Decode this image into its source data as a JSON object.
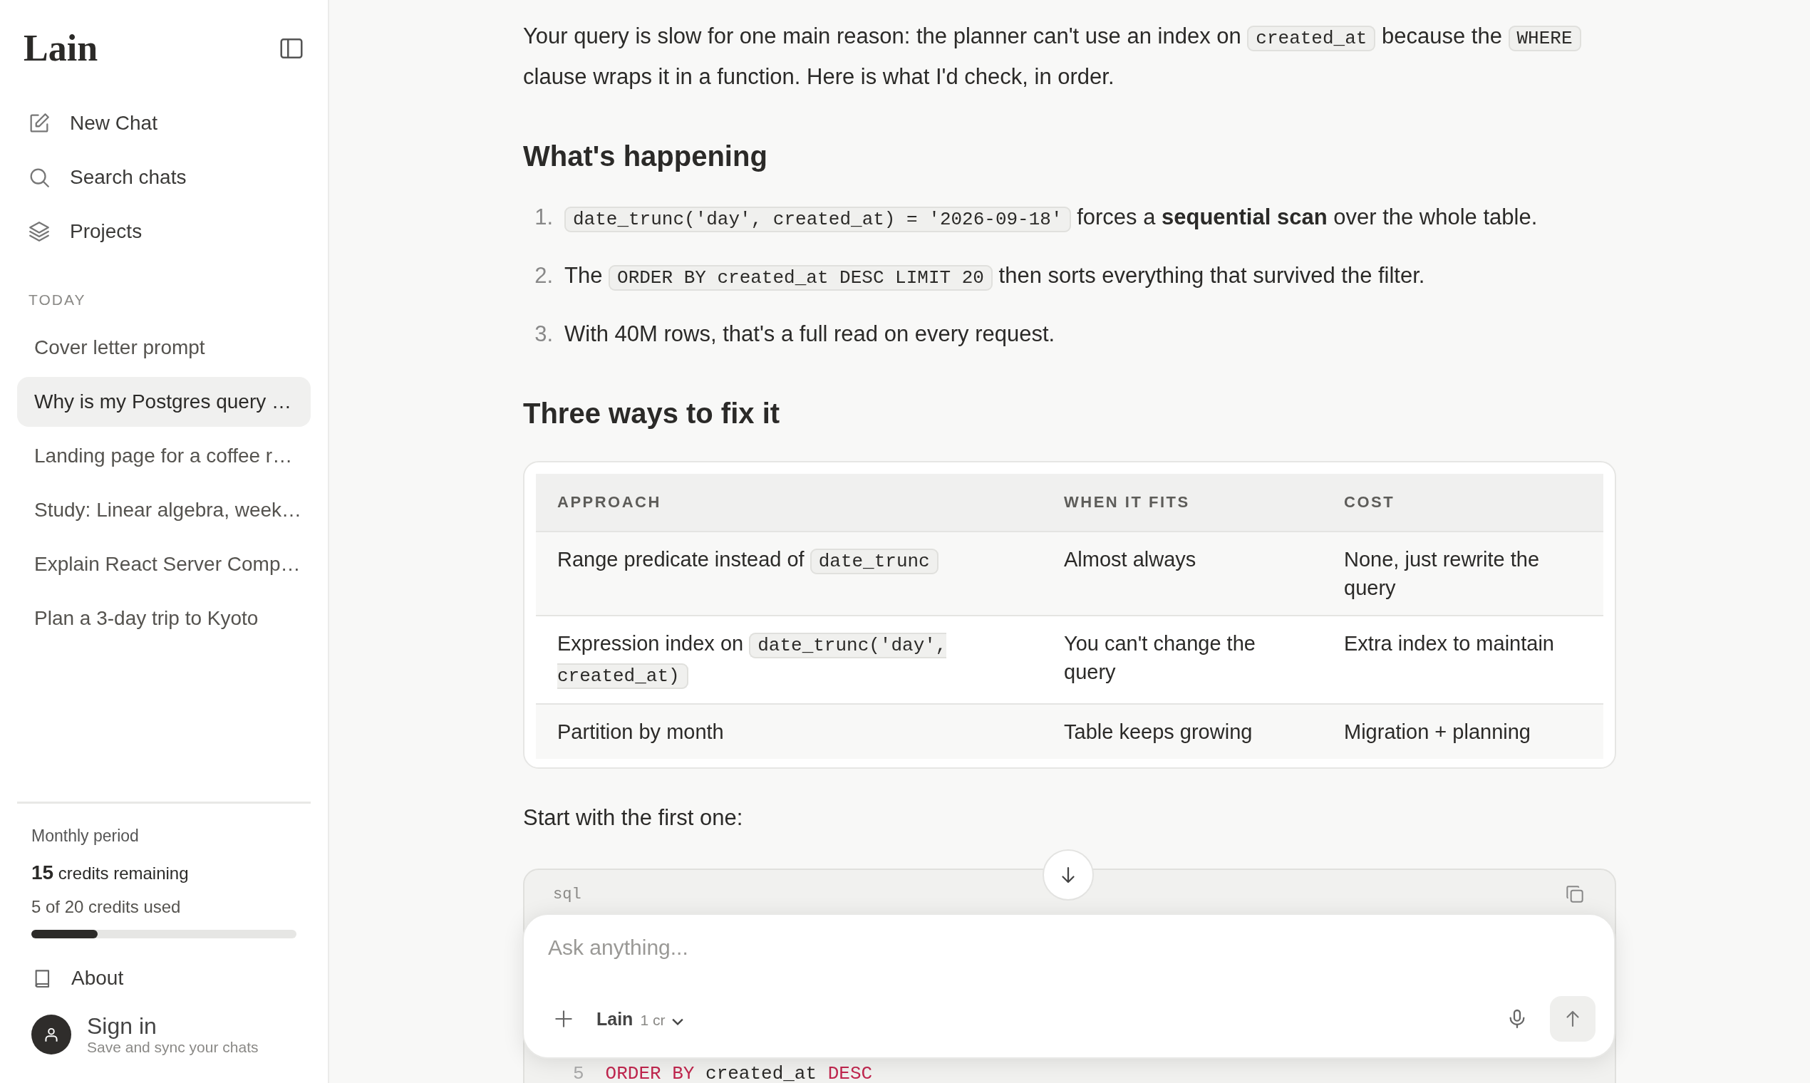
{
  "sidebar": {
    "logo": "Lain",
    "nav": [
      {
        "label": "New Chat"
      },
      {
        "label": "Search chats"
      },
      {
        "label": "Projects"
      }
    ],
    "section_label": "TODAY",
    "chats": [
      {
        "title": "Cover letter prompt",
        "selected": false
      },
      {
        "title": "Why is my Postgres query …",
        "selected": true
      },
      {
        "title": "Landing page for a coffee r…",
        "selected": false
      },
      {
        "title": "Study: Linear algebra, week…",
        "selected": false
      },
      {
        "title": "Explain React Server Comp…",
        "selected": false
      },
      {
        "title": "Plan a 3-day trip to Kyoto",
        "selected": false
      }
    ],
    "usage": {
      "period": "Monthly period",
      "remaining": "**15** credits remaining",
      "used": "5 of 20 credits used",
      "level": 0.25
    },
    "about": "About",
    "account": {
      "title": "Sign in",
      "subtitle": "Save and sync your chats"
    }
  },
  "message": {
    "blocks": [
      {
        "kind": "paragraph",
        "segments": [
          {
            "kind": "text",
            "text": "Your query is slow for one main reason: the planner can't use an index on "
          },
          {
            "kind": "code",
            "text": "created_at"
          },
          {
            "kind": "text",
            "text": " because the "
          },
          {
            "kind": "code",
            "text": "WHERE"
          },
          {
            "kind": "text",
            "text": " clause wraps it in a function. Here is what I'd check, in order."
          }
        ]
      },
      {
        "kind": "heading",
        "text": "What's happening"
      },
      {
        "kind": "list",
        "items": [
          {
            "marker": "1.",
            "segments": [
              {
                "kind": "code",
                "text": "date_trunc('day', created_at) = '2026-09-18'"
              },
              {
                "kind": "text",
                "text": " forces a **sequential scan** over the whole table."
              }
            ]
          },
          {
            "marker": "2.",
            "segments": [
              {
                "kind": "text",
                "text": "The "
              },
              {
                "kind": "code",
                "text": "ORDER BY created_at DESC LIMIT 20"
              },
              {
                "kind": "text",
                "text": " then sorts everything that survived the filter."
              }
            ]
          },
          {
            "marker": "3.",
            "segments": [
              {
                "kind": "text",
                "text": "With 40M rows, that's a full read on every request."
              }
            ]
          }
        ]
      },
      {
        "kind": "heading",
        "text": "Three ways to fix it"
      },
      {
        "kind": "table",
        "columns": [
          "APPROACH",
          "WHEN IT FITS",
          "COST"
        ],
        "rows": [
          [
            [
              {
                "kind": "text",
                "text": "Range predicate instead of "
              },
              {
                "kind": "code",
                "text": "date_trunc"
              }
            ],
            [
              {
                "kind": "text",
                "text": "Almost always"
              }
            ],
            [
              {
                "kind": "text",
                "text": "None, just rewrite the query"
              }
            ]
          ],
          [
            [
              {
                "kind": "text",
                "text": "Expression index on "
              },
              {
                "kind": "code",
                "text": "date_trunc('day', created_at)"
              }
            ],
            [
              {
                "kind": "text",
                "text": "You can't change the query"
              }
            ],
            [
              {
                "kind": "text",
                "text": "Extra index to maintain"
              }
            ]
          ],
          [
            [
              {
                "kind": "text",
                "text": "Partition by month"
              }
            ],
            [
              {
                "kind": "text",
                "text": "Table keeps growing"
              }
            ],
            [
              {
                "kind": "text",
                "text": "Migration + planning"
              }
            ]
          ]
        ]
      },
      {
        "kind": "paragraph",
        "segments": [
          {
            "kind": "text",
            "text": "Start with the first one:"
          }
        ]
      },
      {
        "kind": "code_block",
        "language": "sql",
        "lines": [
          {
            "number": "5",
            "tokens": [
              {
                "kind": "keyword",
                "text": "ORDER BY"
              },
              {
                "kind": "plain",
                "text": " created_at "
              },
              {
                "kind": "keyword",
                "text": "DESC"
              }
            ]
          }
        ]
      }
    ]
  },
  "composer": {
    "placeholder": "Ask anything...",
    "model": "Lain",
    "cost": "1 cr"
  }
}
